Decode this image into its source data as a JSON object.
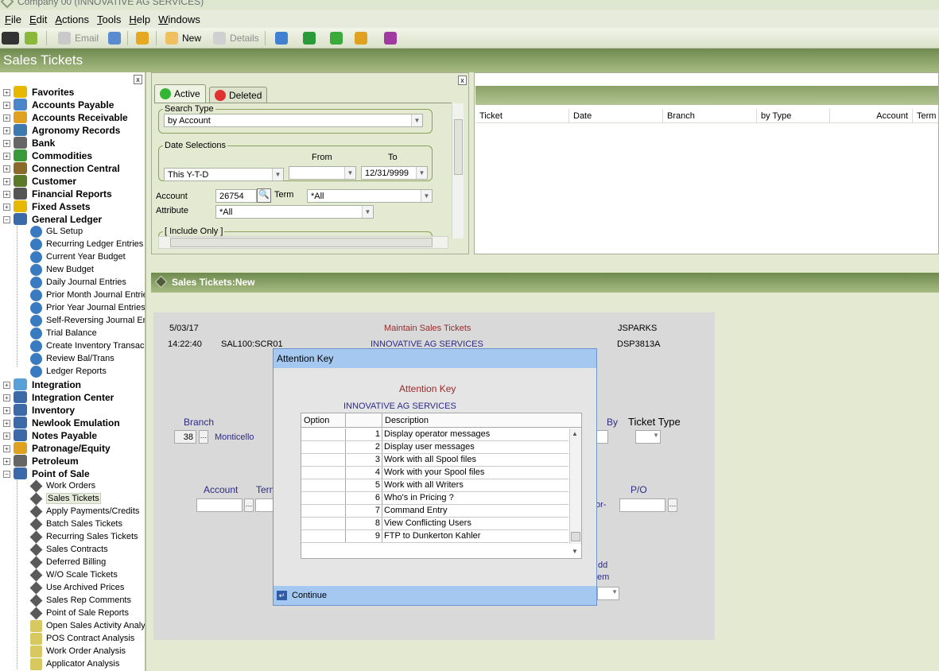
{
  "window": {
    "title": "Company 00 (INNOVATIVE AG SERVICES)"
  },
  "menu": [
    "File",
    "Edit",
    "Actions",
    "Tools",
    "Help",
    "Windows"
  ],
  "toolbar": {
    "email": "Email",
    "new": "New",
    "details": "Details"
  },
  "app_title": "Sales Tickets",
  "tree": {
    "close": "x",
    "top": [
      {
        "label": "Favorites",
        "icon": "star-icon",
        "color": "#e6b800"
      },
      {
        "label": "Accounts Payable",
        "icon": "ap-icon",
        "color": "#4a86c8"
      },
      {
        "label": "Accounts Receivable",
        "icon": "ar-icon",
        "color": "#e0a020"
      },
      {
        "label": "Agronomy Records",
        "icon": "agronomy-icon",
        "color": "#3c7ab0"
      },
      {
        "label": "Bank",
        "icon": "bank-icon",
        "color": "#666666"
      },
      {
        "label": "Commodities",
        "icon": "commodities-icon",
        "color": "#3a9a3a"
      },
      {
        "label": "Connection Central",
        "icon": "connection-icon",
        "color": "#8a6a2a"
      },
      {
        "label": "Customer",
        "icon": "customer-icon",
        "color": "#5a7a2a"
      },
      {
        "label": "Financial Reports",
        "icon": "financial-icon",
        "color": "#555555"
      },
      {
        "label": "Fixed Assets",
        "icon": "fixed-assets-icon",
        "color": "#e6b800"
      },
      {
        "label": "General Ledger",
        "icon": "ledger-icon",
        "color": "#3c6aa8"
      }
    ],
    "gl_children": [
      "GL Setup",
      "Recurring Ledger Entries",
      "Current Year Budget",
      "New Budget",
      "Daily Journal Entries",
      "Prior Month Journal Entrie",
      "Prior Year Journal Entries",
      "Self-Reversing Journal En",
      "Trial Balance",
      "Create Inventory Transac",
      "Review Bal/Trans",
      "Ledger Reports"
    ],
    "middle": [
      {
        "label": "Integration",
        "icon": "integration-icon",
        "color": "#5aa0d8"
      },
      {
        "label": "Integration Center",
        "icon": "integration-center-icon",
        "color": "#3c6aa8"
      },
      {
        "label": "Inventory",
        "icon": "inventory-icon",
        "color": "#3c6aa8"
      },
      {
        "label": "Newlook Emulation",
        "icon": "newlook-icon",
        "color": "#3c6aa8"
      },
      {
        "label": "Notes Payable",
        "icon": "notes-icon",
        "color": "#3c6aa8"
      },
      {
        "label": "Patronage/Equity",
        "icon": "patronage-icon",
        "color": "#e0a020"
      },
      {
        "label": "Petroleum",
        "icon": "petroleum-icon",
        "color": "#666666"
      },
      {
        "label": "Point of Sale",
        "icon": "pos-icon",
        "color": "#3c6aa8"
      }
    ],
    "pos_children": [
      "Work Orders",
      "Sales Tickets",
      "Apply Payments/Credits",
      "Batch Sales Tickets",
      "Recurring Sales Tickets",
      "Sales Contracts",
      "Deferred Billing",
      "W/O Scale Tickets",
      "Use Archived Prices",
      "Sales Rep Comments",
      "Point of Sale Reports",
      "Open Sales Activity Analy",
      "POS Contract Analysis",
      "Work Order Analysis",
      "Applicator Analysis"
    ]
  },
  "search": {
    "close": "x",
    "tab_active": "Active",
    "tab_deleted": "Deleted",
    "search_type_label": "Search Type",
    "search_type_value": "by Account",
    "date_sel_label": "Date Selections",
    "from_label": "From",
    "to_label": "To",
    "date_preset": "This Y-T-D",
    "to_value": "12/31/9999",
    "account_label": "Account",
    "account_value": "26754",
    "term_label": "Term",
    "term_value": "*All",
    "attribute_label": "Attribute",
    "attribute_value": "*All",
    "include_only": "[ Include Only ]"
  },
  "results": {
    "columns": [
      "Ticket",
      "Date",
      "Branch",
      "by Type",
      "Account",
      "Term"
    ]
  },
  "section_title": "Sales Tickets:New",
  "screen": {
    "date": "5/03/17",
    "time": "14:22:40",
    "program": "SAL100:SCR01",
    "title": "Maintain Sales Tickets",
    "company": "INNOVATIVE AG SERVICES",
    "user": "JSPARKS",
    "display": "DSP3813A",
    "branch_label": "Branch",
    "branch_value": "38",
    "branch_name": "Monticello",
    "account_label": "Account",
    "term_label": "Term",
    "by_label": "By",
    "ticket_type_label": "Ticket Type",
    "po_label": "P/O",
    "or_label": "or-",
    "add_label": "dd",
    "em_label": "em"
  },
  "dialog": {
    "title": "Attention Key",
    "heading": "Attention Key",
    "company": "INNOVATIVE AG SERVICES",
    "col_option": "Option",
    "col_description": "Description",
    "rows": [
      {
        "n": "1",
        "desc": "Display operator messages"
      },
      {
        "n": "2",
        "desc": "Display user messages"
      },
      {
        "n": "3",
        "desc": "Work with all Spool files"
      },
      {
        "n": "4",
        "desc": "Work with your Spool files"
      },
      {
        "n": "5",
        "desc": "Work with all Writers"
      },
      {
        "n": "6",
        "desc": "Who's in Pricing ?"
      },
      {
        "n": "7",
        "desc": "Command Entry"
      },
      {
        "n": "8",
        "desc": "View Conflicting Users"
      },
      {
        "n": "9",
        "desc": "FTP to Dunkerton Kahler"
      }
    ],
    "continue": "Continue"
  }
}
